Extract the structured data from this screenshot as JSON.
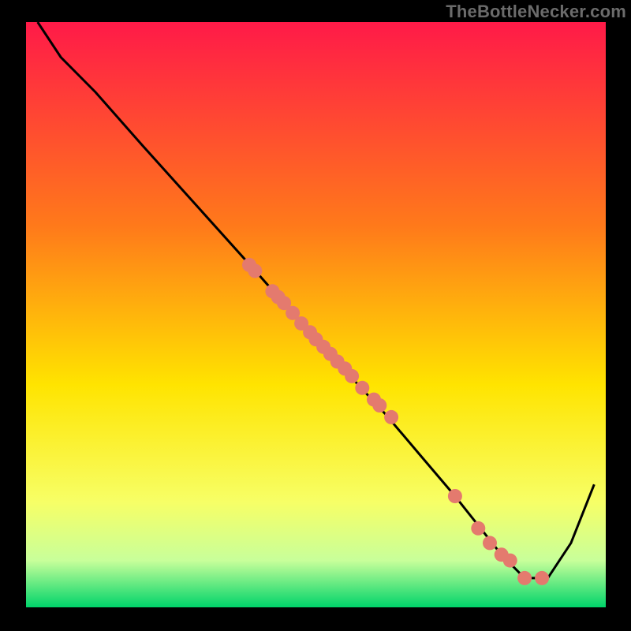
{
  "attribution": "TheBottleNecker.com",
  "colors": {
    "gradient_top": "#ff1a48",
    "gradient_mid_upper": "#ff7a1a",
    "gradient_mid": "#ffe400",
    "gradient_lower": "#f7ff66",
    "gradient_band": "#c8ff9a",
    "gradient_bottom": "#00d46a",
    "curve": "#000000",
    "dot": "#e47a6e"
  },
  "chart_data": {
    "type": "line",
    "title": "",
    "xlabel": "",
    "ylabel": "",
    "xlim": [
      0,
      100
    ],
    "ylim": [
      0,
      100
    ],
    "curve": {
      "x": [
        2,
        6,
        12,
        20,
        30,
        40,
        48,
        55,
        62,
        68,
        74,
        78,
        82,
        86,
        90,
        94,
        98
      ],
      "y": [
        100,
        94,
        88,
        79,
        68,
        57,
        48,
        40.5,
        33,
        26,
        19,
        14,
        9,
        5,
        5,
        11,
        21
      ]
    },
    "series": [
      {
        "name": "cluster-dots",
        "x": [
          38.5,
          39.5,
          42.5,
          43.5,
          44.5,
          46,
          47.5,
          49,
          50,
          51.3,
          52.5,
          53.7,
          55,
          56.2,
          58,
          60,
          61,
          63,
          74,
          78,
          80,
          82,
          83.5,
          86,
          89
        ],
        "y": [
          58.5,
          57.5,
          54,
          53,
          52,
          50.3,
          48.5,
          47,
          45.8,
          44.5,
          43.3,
          42,
          40.8,
          39.5,
          37.5,
          35.5,
          34.5,
          32.5,
          19,
          13.5,
          11,
          9,
          8,
          5,
          5
        ]
      }
    ]
  }
}
